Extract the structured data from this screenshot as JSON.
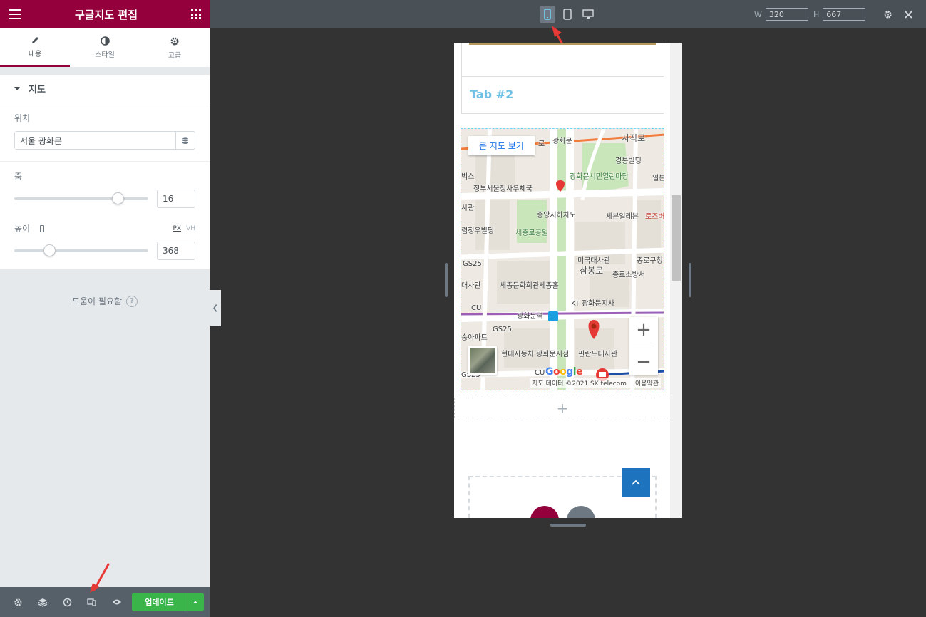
{
  "panel": {
    "title": "구글지도 편집",
    "tabs": [
      {
        "label": "내용",
        "icon": "pencil-icon",
        "active": true
      },
      {
        "label": "스타일",
        "icon": "contrast-icon",
        "active": false
      },
      {
        "label": "고급",
        "icon": "gear-icon",
        "active": false
      }
    ],
    "section_title": "지도",
    "location": {
      "label": "위치",
      "value": "서울 광화문"
    },
    "zoom": {
      "label": "줌",
      "value": "16",
      "fraction": 0.8
    },
    "height": {
      "label": "높이",
      "value": "368",
      "unit_px": "PX",
      "unit_vh": "VH",
      "fraction": 0.24
    },
    "help": "도움이 필요함",
    "update_label": "업데이트",
    "accent_color": "#93003c",
    "update_color": "#39b54a"
  },
  "topbar": {
    "width_label": "W",
    "width_value": "320",
    "height_label": "H",
    "height_value": "667",
    "active_device": "mobile"
  },
  "preview": {
    "tab_title": "Tab #2",
    "big_map_label": "큰 지도 보기",
    "attribution": "지도 데이터 ©2021 SK telecom",
    "terms": "이용약관",
    "google": "Google",
    "map_labels": [
      "광화문",
      "사직로",
      "경통빌딩",
      "광화문시민열린마당",
      "일본",
      "벅스",
      "정부서울청사우체국",
      "중앙지하차도",
      "세븐일레븐",
      "로즈버",
      "사관",
      "렴정우빌딩",
      "세종로공원",
      "미국대사관",
      "종로구청",
      "삼봉로",
      "GS25",
      "종로소방서",
      "대사관",
      "세종문화회관세종홀",
      "KT 광화문지사",
      "CU",
      "광화문역",
      "숭아파트",
      "GS25",
      "현대자동차 광화문지점",
      "핀란드대사관",
      "GS25",
      "CU",
      "로"
    ]
  }
}
